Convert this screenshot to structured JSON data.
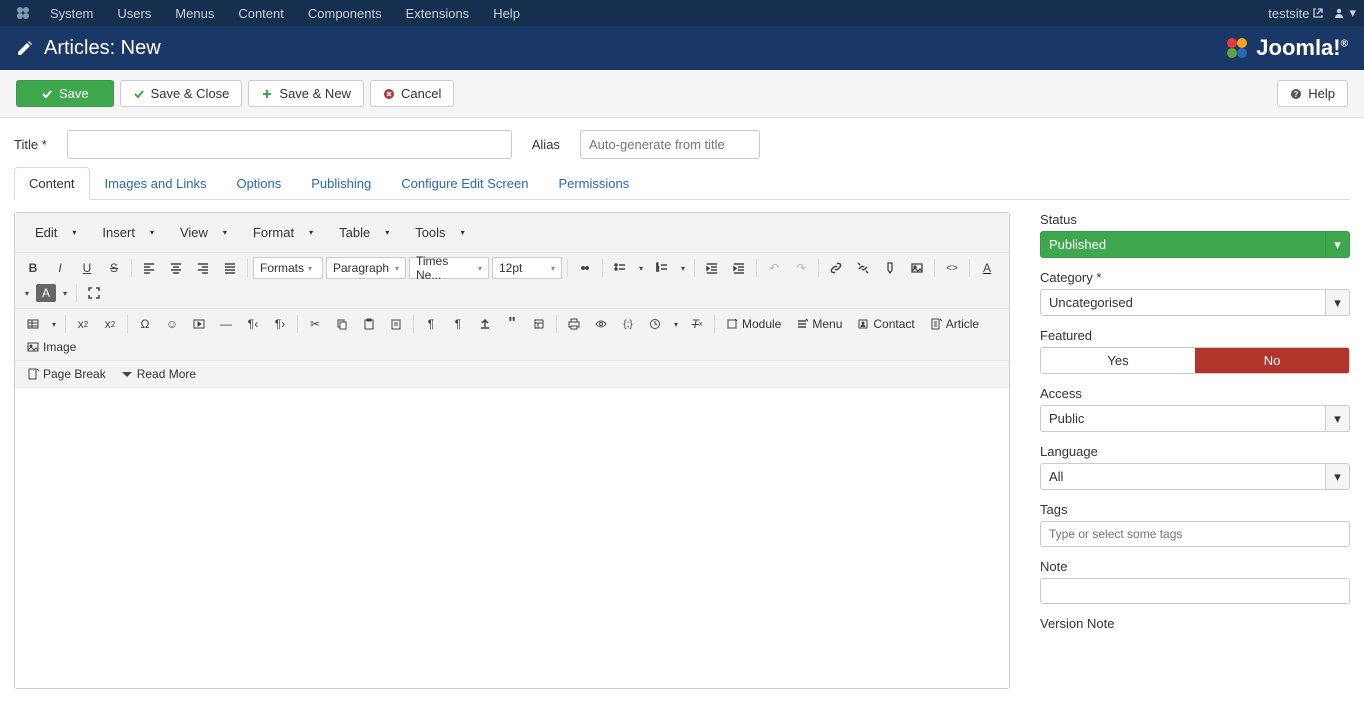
{
  "topmenu": {
    "items": [
      "System",
      "Users",
      "Menus",
      "Content",
      "Components",
      "Extensions",
      "Help"
    ],
    "sitename": "testsite"
  },
  "header": {
    "title": "Articles: New",
    "brand": "Joomla!"
  },
  "toolbar": {
    "save": "Save",
    "save_close": "Save & Close",
    "save_new": "Save & New",
    "cancel": "Cancel",
    "help": "Help"
  },
  "form": {
    "title_label": "Title *",
    "alias_label": "Alias",
    "alias_placeholder": "Auto-generate from title"
  },
  "tabs": {
    "content": "Content",
    "images_links": "Images and Links",
    "options": "Options",
    "publishing": "Publishing",
    "configure": "Configure Edit Screen",
    "permissions": "Permissions"
  },
  "editor_menu": {
    "edit": "Edit",
    "insert": "Insert",
    "view": "View",
    "format": "Format",
    "table": "Table",
    "tools": "Tools"
  },
  "editor_selects": {
    "formats": "Formats",
    "paragraph": "Paragraph",
    "font": "Times Ne...",
    "size": "12pt"
  },
  "editor_buttons": {
    "module": "Module",
    "menu": "Menu",
    "contact": "Contact",
    "article": "Article",
    "image": "Image",
    "page_break": "Page Break",
    "read_more": "Read More"
  },
  "sidebar": {
    "status_label": "Status",
    "status_value": "Published",
    "category_label": "Category *",
    "category_value": "Uncategorised",
    "featured_label": "Featured",
    "featured_yes": "Yes",
    "featured_no": "No",
    "access_label": "Access",
    "access_value": "Public",
    "language_label": "Language",
    "language_value": "All",
    "tags_label": "Tags",
    "tags_placeholder": "Type or select some tags",
    "note_label": "Note",
    "version_note_label": "Version Note"
  }
}
